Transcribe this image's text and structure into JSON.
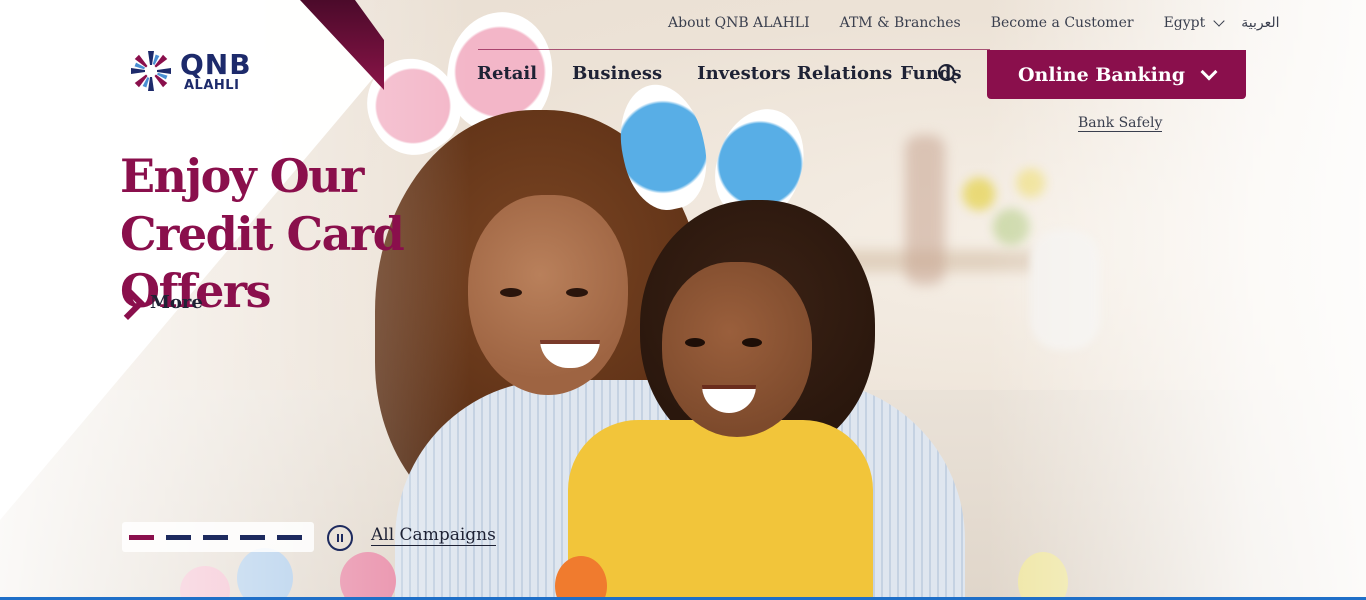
{
  "brand": {
    "name": "QNB",
    "sub": "ALAHLI"
  },
  "top_links": {
    "about": "About QNB ALAHLI",
    "atm": "ATM & Branches",
    "become_customer": "Become a Customer",
    "country": "Egypt",
    "language": "العربية"
  },
  "main_nav": {
    "retail": "Retail",
    "business": "Business",
    "investors": "Investors Relations",
    "funds": "Funds"
  },
  "online_banking": {
    "label": "Online Banking"
  },
  "bank_safely": "Bank Safely",
  "hero": {
    "title": "Enjoy Our Credit Card Offers",
    "more": "More"
  },
  "slider": {
    "total": 5,
    "active_index": 0,
    "all_campaigns": "All Campaigns"
  },
  "colors": {
    "brand_maroon": "#8a0f4c",
    "brand_navy": "#1d2a6b",
    "accent_blue": "#1f6fc8"
  },
  "icons": [
    "qnb-logo-icon",
    "chevron-down-icon",
    "search-icon",
    "chevron-right-icon",
    "pause-icon"
  ]
}
